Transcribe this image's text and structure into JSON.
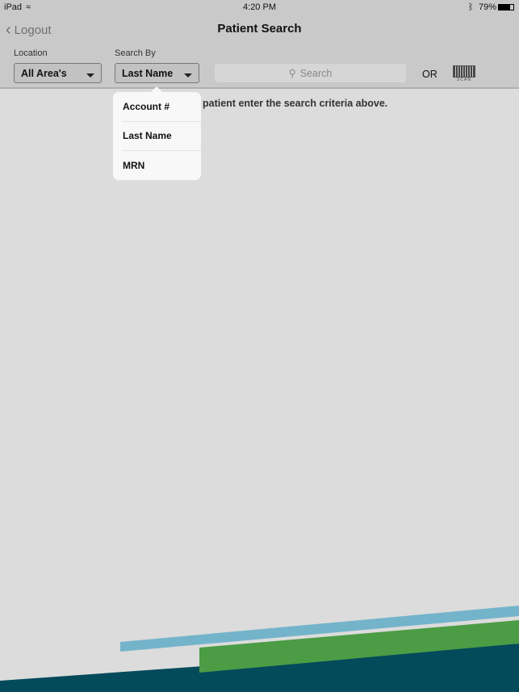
{
  "status_bar": {
    "device": "iPad",
    "time": "4:20 PM",
    "battery": "79%"
  },
  "nav": {
    "back_label": "Logout",
    "title": "Patient Search"
  },
  "filters": {
    "location_label": "Location",
    "location_value": "All Area's",
    "search_by_label": "Search By",
    "search_by_value": "Last Name",
    "search_placeholder": "Search",
    "or_label": "OR",
    "scan_label": "SCAN"
  },
  "message": "patient enter the search criteria above.",
  "dropdown": {
    "options": [
      "Account #",
      "Last Name",
      "MRN"
    ]
  },
  "colors": {
    "light_blue": "#74b4cb",
    "green": "#4b9c45",
    "dark_teal": "#034a5b"
  }
}
